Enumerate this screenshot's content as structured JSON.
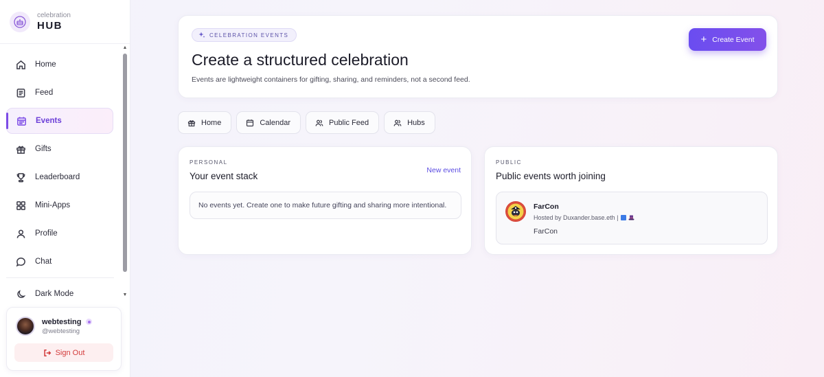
{
  "brand": {
    "small": "celebration",
    "big": "HUB"
  },
  "sidebar": {
    "items": [
      {
        "label": "Home",
        "icon": "home-icon"
      },
      {
        "label": "Feed",
        "icon": "feed-icon"
      },
      {
        "label": "Events",
        "icon": "calendar-icon",
        "active": true
      },
      {
        "label": "Gifts",
        "icon": "gift-icon"
      },
      {
        "label": "Leaderboard",
        "icon": "trophy-icon"
      },
      {
        "label": "Mini-Apps",
        "icon": "grid-icon"
      },
      {
        "label": "Profile",
        "icon": "user-icon"
      },
      {
        "label": "Chat",
        "icon": "chat-icon"
      }
    ],
    "dark_mode_label": "Dark Mode"
  },
  "user": {
    "name": "webtesting",
    "handle": "@webtesting",
    "signout_label": "Sign Out"
  },
  "hero": {
    "chip": "CELEBRATION EVENTS",
    "title": "Create a structured celebration",
    "subtitle": "Events are lightweight containers for gifting, sharing, and reminders, not a second feed.",
    "create_label": "Create Event"
  },
  "tabs": [
    {
      "label": "Home",
      "icon": "gift-icon"
    },
    {
      "label": "Calendar",
      "icon": "calendar-icon"
    },
    {
      "label": "Public Feed",
      "icon": "users-icon"
    },
    {
      "label": "Hubs",
      "icon": "users-icon"
    }
  ],
  "personal": {
    "eyebrow": "PERSONAL",
    "title": "Your event stack",
    "link": "New event",
    "empty": "No events yet. Create one to make future gifting and sharing more intentional."
  },
  "public": {
    "eyebrow": "PUBLIC",
    "title": "Public events worth joining",
    "event": {
      "name": "FarCon",
      "host": "Hosted by Duxander.base.eth |",
      "description": "FarCon"
    }
  },
  "colors": {
    "accent": "#7c4be6",
    "danger": "#d33a3a",
    "link": "#5a4be2"
  }
}
